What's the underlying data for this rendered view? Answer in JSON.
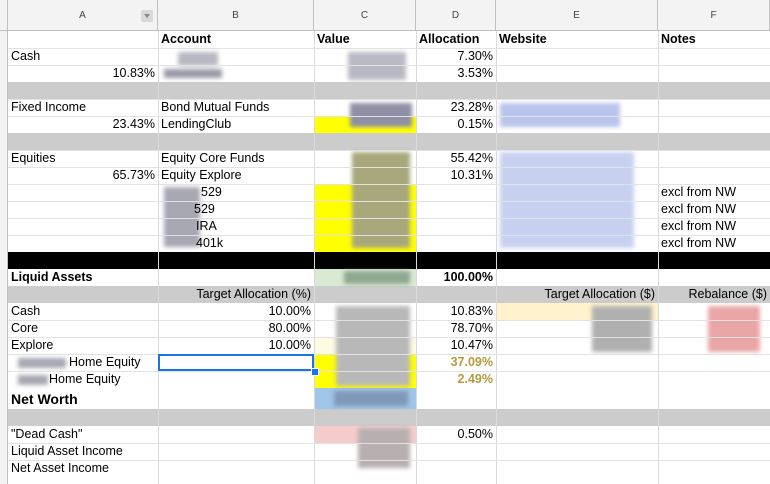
{
  "columns": [
    "A",
    "B",
    "C",
    "D",
    "E",
    "F"
  ],
  "colors": {
    "header_gray": "#f3f3f3",
    "band_gray": "#cccccc",
    "highlight_yellow": "#ffff00",
    "dark_band": "#000000",
    "liquid_green": "#d9ead3",
    "light_blue": "#9fc5e8",
    "pink": "#f4cccc",
    "beige": "#fff2cc",
    "olive_text": "#b59a3c",
    "selection_blue": "#1a73e8"
  },
  "icons": {
    "column_a_dropdown": "filter-dropdown-icon"
  },
  "header_row": {
    "account": "Account",
    "value": "Value",
    "allocation": "Allocation",
    "website": "Website",
    "notes": "Notes"
  },
  "cash": {
    "label": "Cash",
    "pct": "10.83%",
    "alloc1": "7.30%",
    "alloc2": "3.53%"
  },
  "fixed_income": {
    "label": "Fixed Income",
    "pct": "23.43%",
    "acct1": "Bond Mutual Funds",
    "acct2": "LendingClub",
    "alloc1": "23.28%",
    "alloc2": "0.15%"
  },
  "equities": {
    "label": "Equities",
    "pct": "65.73%",
    "acct1": "Equity Core Funds",
    "acct2": "Equity Explore",
    "acct3": "529",
    "acct4": "529",
    "acct5": "IRA",
    "acct6": "401k",
    "alloc1": "55.42%",
    "alloc2": "10.31%",
    "note": "excl from NW"
  },
  "liquid": {
    "label": "Liquid Assets",
    "alloc": "100.00%"
  },
  "target_header": {
    "target_pct": "Target Allocation (%)",
    "target_usd": "Target Allocation ($)",
    "rebalance": "Rebalance ($)"
  },
  "targets": [
    {
      "name": "Cash",
      "target": "10.00%",
      "actual": "10.83%"
    },
    {
      "name": "Core",
      "target": "80.00%",
      "actual": "78.70%"
    },
    {
      "name": "Explore",
      "target": "10.00%",
      "actual": "10.47%"
    }
  ],
  "home_equity": {
    "row1_label": "Home Equity",
    "row1_alloc": "37.09%",
    "row2_label": "Home Equity",
    "row2_alloc": "2.49%"
  },
  "net_worth": {
    "label": "Net Worth"
  },
  "bottom": {
    "dead_cash": "\"Dead Cash\"",
    "dead_cash_alloc": "0.50%",
    "liquid_income": "Liquid Asset Income",
    "net_income": "Net Asset Income"
  }
}
